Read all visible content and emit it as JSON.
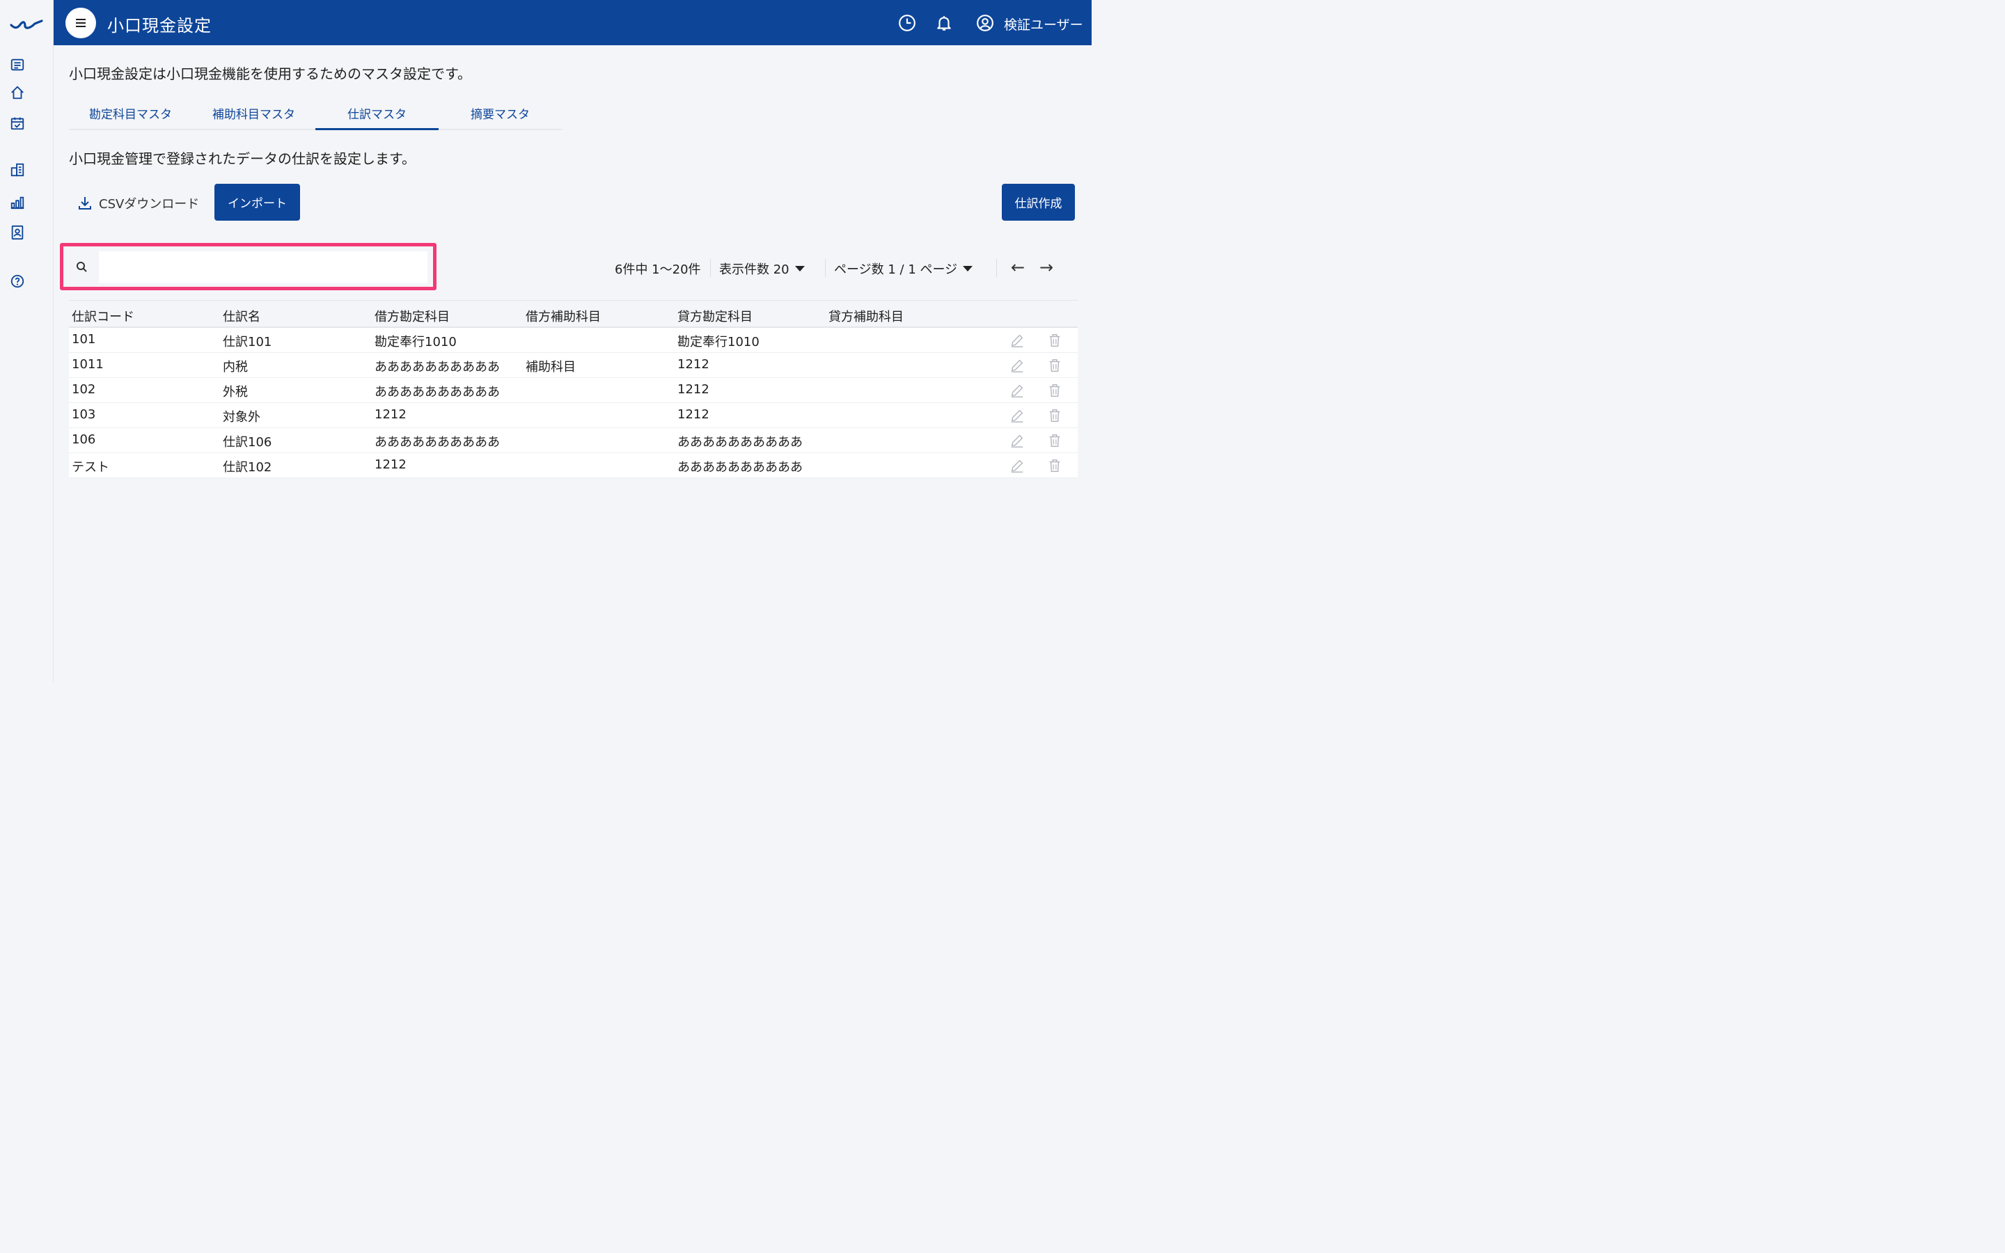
{
  "header": {
    "title": "小口現金設定",
    "user": "検証ユーザー"
  },
  "intro": "小口現金設定は小口現金機能を使用するためのマスタ設定です。",
  "tabs": [
    {
      "label": "勘定科目マスタ"
    },
    {
      "label": "補助科目マスタ"
    },
    {
      "label": "仕訳マスタ"
    },
    {
      "label": "摘要マスタ"
    }
  ],
  "description": "小口現金管理で登録されたデータの仕訳を設定します。",
  "toolbar": {
    "csv_label": "CSVダウンロード",
    "import_label": "インポート",
    "create_label": "仕訳作成"
  },
  "search": {
    "value": "",
    "placeholder": ""
  },
  "pager": {
    "summary": "6件中 1〜20件",
    "per_page": "表示件数 20",
    "page": "ページ数 1 / 1 ページ"
  },
  "table": {
    "headers": [
      "仕訳コード",
      "仕訳名",
      "借方勘定科目",
      "借方補助科目",
      "貸方勘定科目",
      "貸方補助科目"
    ],
    "rows": [
      [
        "101",
        "仕訳101",
        "勘定奉行1010",
        "",
        "勘定奉行1010",
        ""
      ],
      [
        "1011",
        "内税",
        "ああああああああああ",
        "補助科目",
        "1212",
        ""
      ],
      [
        "102",
        "外税",
        "ああああああああああ",
        "",
        "1212",
        ""
      ],
      [
        "103",
        "対象外",
        "1212",
        "",
        "1212",
        ""
      ],
      [
        "106",
        "仕訳106",
        "ああああああああああ",
        "",
        "ああああああああああ",
        ""
      ],
      [
        "テスト",
        "仕訳102",
        "1212",
        "",
        "ああああああああああ",
        ""
      ]
    ]
  },
  "colors": {
    "brand": "#0d4599",
    "highlight": "#f23a76"
  }
}
